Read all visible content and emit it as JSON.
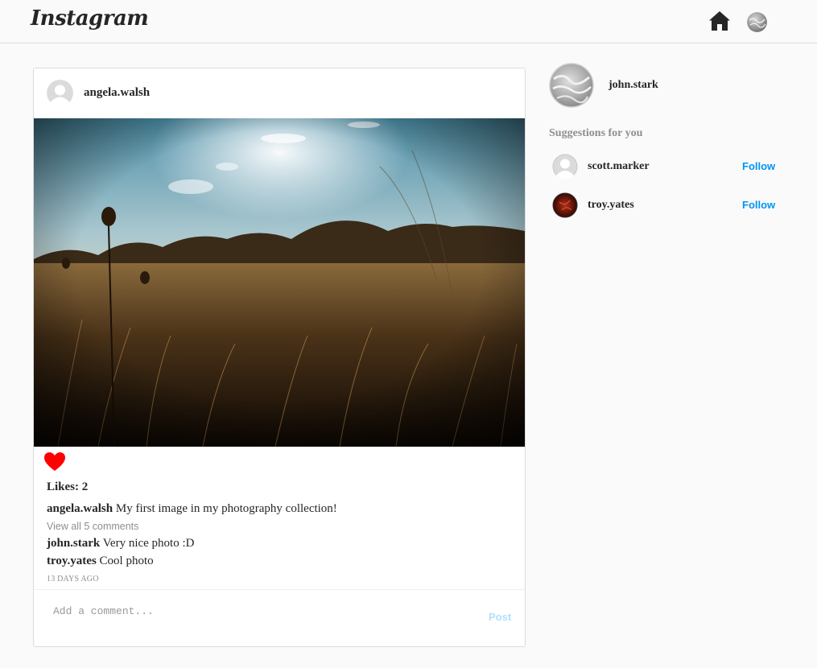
{
  "header": {
    "logo_text": "Instagram",
    "icons": [
      "home-icon",
      "profile-avatar"
    ]
  },
  "post": {
    "author": "angela.walsh",
    "image_description_icon": "field-photo",
    "likes_label": "Likes:",
    "likes_count": "2",
    "liked": true,
    "like_color": "#ff0000",
    "caption_user": "angela.walsh",
    "caption_text": "My first image in my photography collection!",
    "view_comments": "View all 5 comments",
    "comments": [
      {
        "user": "john.stark",
        "text": "Very nice photo :D"
      },
      {
        "user": "troy.yates",
        "text": "Cool photo"
      }
    ],
    "timestamp": "13 DAYS AGO",
    "comment_placeholder": "Add a comment...",
    "post_button": "Post"
  },
  "sidebar": {
    "current_user": "john.stark",
    "suggestions_title": "Suggestions for you",
    "suggestions": [
      {
        "username": "scott.marker",
        "follow_label": "Follow"
      },
      {
        "username": "troy.yates",
        "follow_label": "Follow"
      }
    ]
  },
  "colors": {
    "accent": "#0095f6",
    "post_button_disabled": "#b2dffc",
    "border": "#dbdbdb",
    "background": "#fafafa"
  }
}
